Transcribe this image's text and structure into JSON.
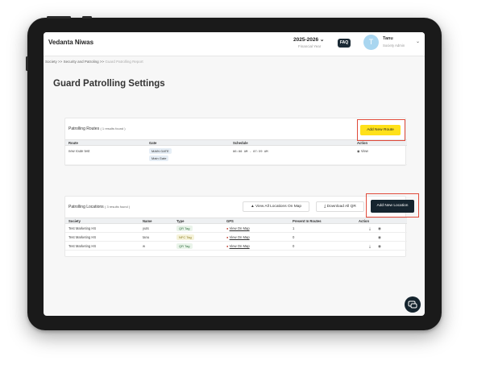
{
  "header": {
    "brand": "Vedanta Niwas",
    "year_label": "2025-2026",
    "year_sub": "Financial Year",
    "faq": "FAQ",
    "avatar_initial": "T",
    "user_name": "Tanu",
    "user_role": "Society Admin"
  },
  "breadcrumb": {
    "items": [
      "Society",
      ">>",
      "Security and Patroling",
      ">>",
      "Guard Patrolling Report"
    ]
  },
  "page_title": "Guard Patrolling Settings",
  "routes": {
    "title": "Patrolling Routes",
    "count": "( 1 results found )",
    "add_button": "Add New Route",
    "columns": [
      "Route",
      "Gate",
      "Schedule",
      "Action"
    ],
    "rows": [
      {
        "route": "new route test",
        "gates": [
          "MAIN GATE",
          "Main Gate"
        ],
        "schedule": "06:00 AM - 07:59 AM",
        "action": "View"
      }
    ]
  },
  "locations": {
    "title": "Patrolling Locations",
    "count": "( 3 results found )",
    "view_map_button": "View All Locations On Map",
    "download_button": "Download All QR",
    "add_button": "Add New Location",
    "columns": [
      "Society",
      "Name",
      "Type",
      "GPS",
      "Present In Routes",
      "Action"
    ],
    "rows": [
      {
        "society": "Test Marketing HS",
        "name": "yuts",
        "type": "QR Tag",
        "gps": "View On Map",
        "routes": "1"
      },
      {
        "society": "Test Marketing HS",
        "name": "tanu",
        "type": "NFC Tag",
        "gps": "View On Map",
        "routes": "0"
      },
      {
        "society": "Test Marketing HS",
        "name": "w",
        "type": "QR Tag",
        "gps": "View On Map",
        "routes": "0"
      }
    ]
  },
  "colors": {
    "accent_yellow": "#ffe11a",
    "dark_button": "#15242e",
    "highlight": "#e04a3a"
  }
}
